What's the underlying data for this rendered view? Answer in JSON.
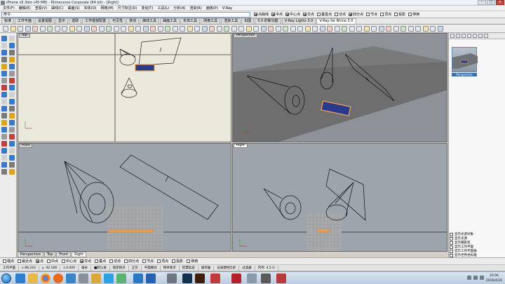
{
  "window": {
    "title": "iPhone v5.3dm (45 MB) - Rhinoceros Corporate (64 bit) - [Right]"
  },
  "menubar": [
    "文件(F)",
    "编辑(E)",
    "查看(V)",
    "曲线(C)",
    "曲面(S)",
    "实体(O)",
    "网格(M)",
    "尺寸标注(D)",
    "变动(T)",
    "工具(L)",
    "分析(A)",
    "渲染(R)",
    "面板(P)",
    "V-Ray"
  ],
  "command": {
    "value": "命令:"
  },
  "snaps": [
    {
      "label": "点曲线",
      "checked": true
    },
    {
      "label": "中点",
      "checked": true
    },
    {
      "label": "中心点",
      "checked": true
    },
    {
      "label": "交点",
      "checked": true
    },
    {
      "label": "垂直点",
      "checked": false
    },
    {
      "label": "切点",
      "checked": false
    },
    {
      "label": "四分点",
      "checked": true
    },
    {
      "label": "节点",
      "checked": false
    },
    {
      "label": "顶点",
      "checked": false
    },
    {
      "label": "投影",
      "checked": false
    },
    {
      "label": "停用",
      "checked": false
    }
  ],
  "toolbar_tabs": [
    {
      "label": "标准",
      "active": false
    },
    {
      "label": "工作平面",
      "active": false
    },
    {
      "label": "设置视图",
      "active": false
    },
    {
      "label": "显示",
      "active": false
    },
    {
      "label": "选取",
      "active": false
    },
    {
      "label": "工作视窗配置",
      "active": false
    },
    {
      "label": "可见性",
      "active": false
    },
    {
      "label": "变动",
      "active": false
    },
    {
      "label": "曲线工具",
      "active": false
    },
    {
      "label": "曲面工具",
      "active": false
    },
    {
      "label": "实体工具",
      "active": false
    },
    {
      "label": "网格工具",
      "active": false
    },
    {
      "label": "渲染工具",
      "active": false
    },
    {
      "label": "出图",
      "active": false
    },
    {
      "label": "5.0 的新功能",
      "active": false
    },
    {
      "label": "V-Ray Lights 3.0",
      "active": false
    },
    {
      "label": "V-Ray for Rhino 3.0",
      "active": true
    }
  ],
  "viewports": {
    "top": "Top",
    "perspective": "Perspective",
    "front": "Front",
    "right": "Right"
  },
  "viewport_tabs": [
    {
      "label": "Perspective",
      "active": false
    },
    {
      "label": "Top",
      "active": false
    },
    {
      "label": "Front",
      "active": false
    },
    {
      "label": "Right",
      "active": true
    }
  ],
  "right_panel": {
    "thumbnail_label": "Perspective",
    "options": [
      "显示光源对象",
      "显示光源",
      "显示摄影机",
      "显示工作平面",
      "显示工作平面轴",
      "显示世界坐标轴",
      "自动隐藏光源",
      "显示未选取网格"
    ]
  },
  "osnaps": [
    {
      "label": "端点",
      "checked": false
    },
    {
      "label": "最近点",
      "checked": false
    },
    {
      "label": "点",
      "checked": true
    },
    {
      "label": "中点",
      "checked": false
    },
    {
      "label": "中心点",
      "checked": false
    },
    {
      "label": "交点",
      "checked": true
    },
    {
      "label": "垂点",
      "checked": false
    },
    {
      "label": "切点",
      "checked": false
    },
    {
      "label": "四分点",
      "checked": false
    },
    {
      "label": "节点",
      "checked": false
    },
    {
      "label": "顶点",
      "checked": false
    },
    {
      "label": "投影",
      "checked": false
    },
    {
      "label": "停用",
      "checked": false
    }
  ],
  "status": [
    "工作平面",
    "x 88.243",
    "y -42.506",
    "z 0.000",
    "毫米",
    "■默认值",
    "锁定格点",
    "正交",
    "平面模式",
    "物件锁点",
    "智慧轨迹",
    "操作轴",
    "记录建构历史",
    "过滤器",
    "内存: 4.5 G"
  ],
  "clock": {
    "time": "20:06",
    "date": "2016/4/20"
  }
}
